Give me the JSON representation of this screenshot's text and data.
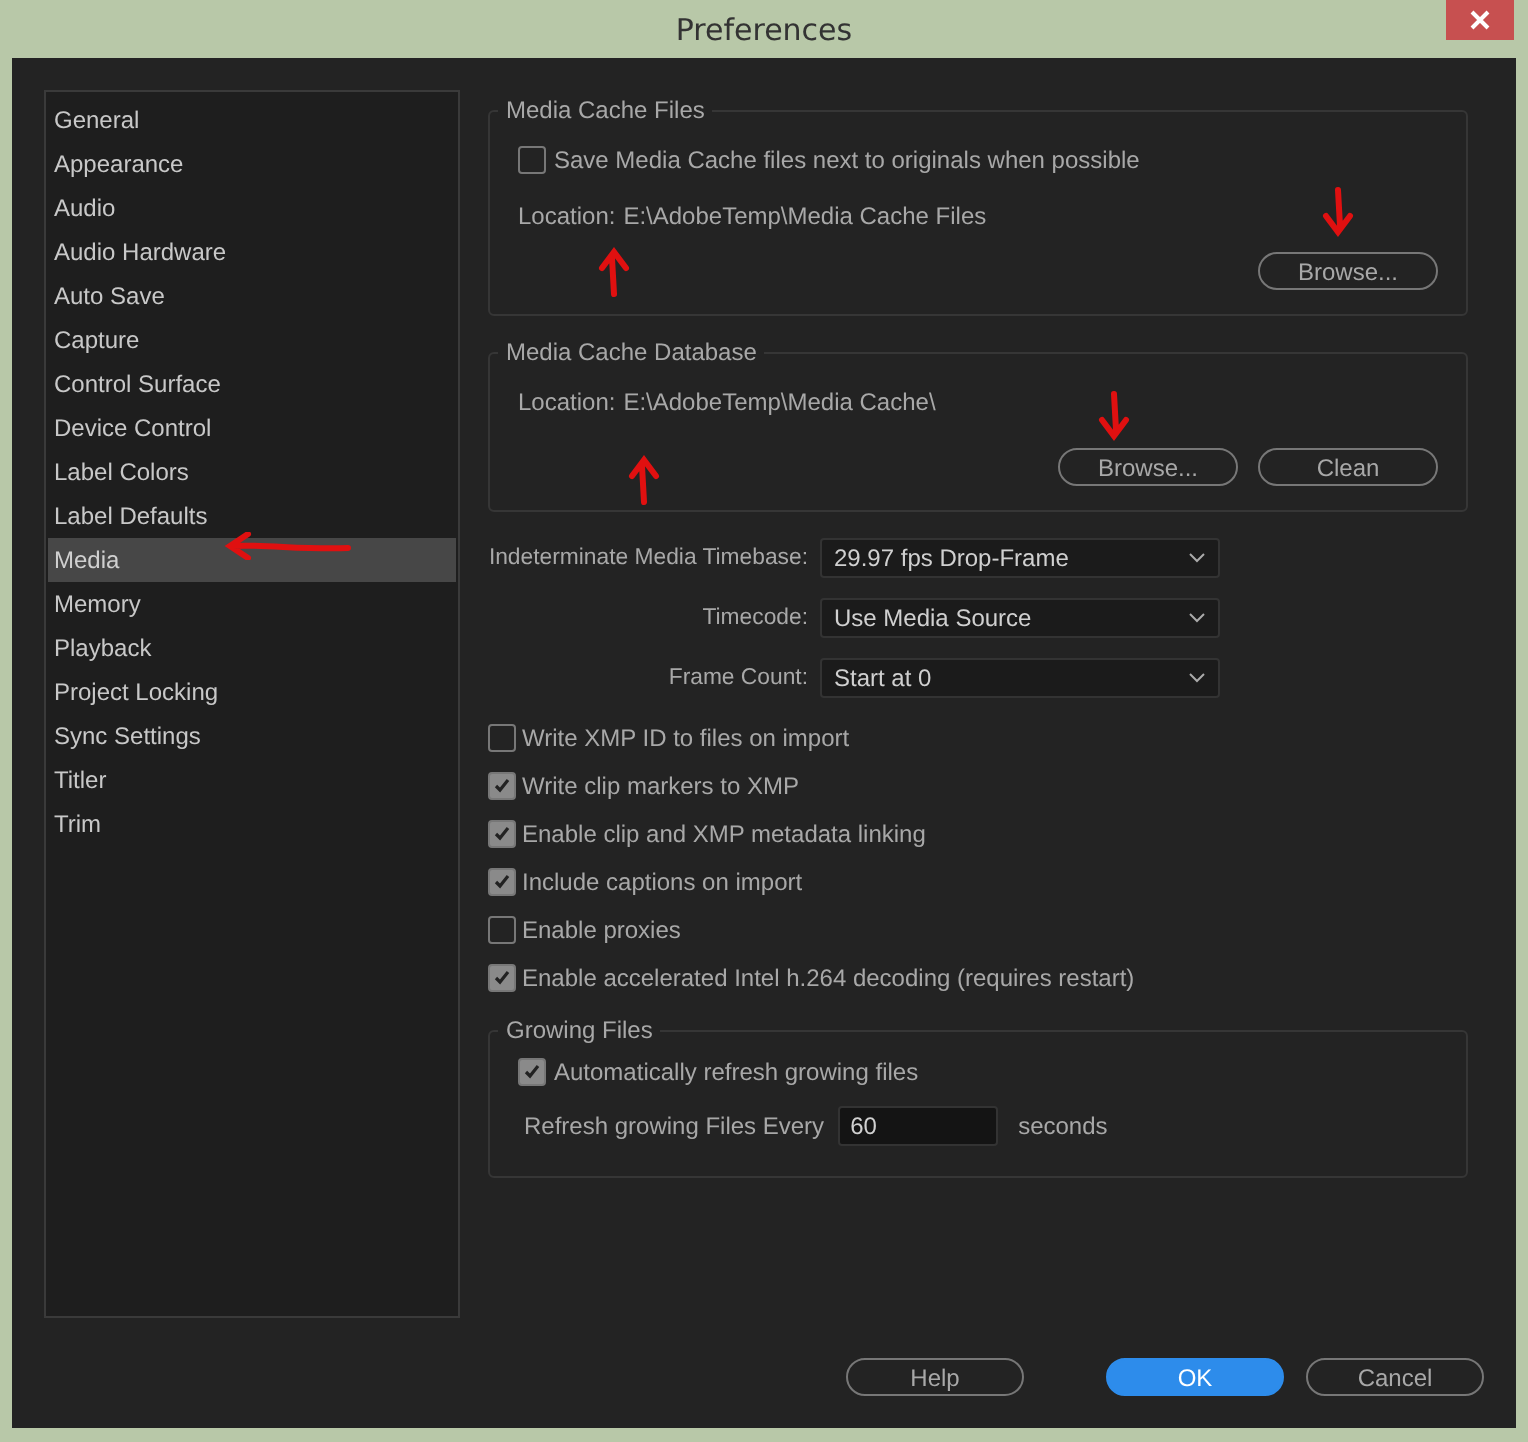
{
  "window": {
    "title": "Preferences"
  },
  "sidebar": {
    "items": [
      {
        "label": "General",
        "selected": false
      },
      {
        "label": "Appearance",
        "selected": false
      },
      {
        "label": "Audio",
        "selected": false
      },
      {
        "label": "Audio Hardware",
        "selected": false
      },
      {
        "label": "Auto Save",
        "selected": false
      },
      {
        "label": "Capture",
        "selected": false
      },
      {
        "label": "Control Surface",
        "selected": false
      },
      {
        "label": "Device Control",
        "selected": false
      },
      {
        "label": "Label Colors",
        "selected": false
      },
      {
        "label": "Label Defaults",
        "selected": false
      },
      {
        "label": "Media",
        "selected": true
      },
      {
        "label": "Memory",
        "selected": false
      },
      {
        "label": "Playback",
        "selected": false
      },
      {
        "label": "Project Locking",
        "selected": false
      },
      {
        "label": "Sync Settings",
        "selected": false
      },
      {
        "label": "Titler",
        "selected": false
      },
      {
        "label": "Trim",
        "selected": false
      }
    ]
  },
  "media_cache_files": {
    "title": "Media Cache Files",
    "checkbox": {
      "label": "Save Media Cache files next to originals when possible",
      "checked": false
    },
    "location_label": "Location:",
    "location_path": "E:\\AdobeTemp\\Media Cache Files",
    "buttons": [
      "Browse..."
    ]
  },
  "media_cache_database": {
    "title": "Media Cache Database",
    "location_label": "Location:",
    "location_path": "E:\\AdobeTemp\\Media Cache\\",
    "buttons": [
      "Browse...",
      "Clean"
    ]
  },
  "dropdowns": [
    {
      "label": "Indeterminate Media Timebase:",
      "value": "29.97 fps Drop-Frame"
    },
    {
      "label": "Timecode:",
      "value": "Use Media Source"
    },
    {
      "label": "Frame Count:",
      "value": "Start at 0"
    }
  ],
  "options": [
    {
      "label": "Write XMP ID to files  on import",
      "checked": false
    },
    {
      "label": "Write clip markers to XMP",
      "checked": true
    },
    {
      "label": "Enable clip and XMP metadata linking",
      "checked": true
    },
    {
      "label": "Include captions on import",
      "checked": true
    },
    {
      "label": "Enable proxies",
      "checked": false
    },
    {
      "label": "Enable accelerated Intel h.264 decoding (requires restart)",
      "checked": true
    }
  ],
  "growing_files": {
    "title": "Growing Files",
    "auto_refresh": {
      "label": "Automatically refresh growing files",
      "checked": true
    },
    "interval_label": "Refresh growing Files Every",
    "interval_value": "60",
    "unit": "seconds"
  },
  "footer_buttons": [
    {
      "label": "Help",
      "kind": "default"
    },
    {
      "label": "OK",
      "kind": "primary"
    },
    {
      "label": "Cancel",
      "kind": "default"
    }
  ]
}
